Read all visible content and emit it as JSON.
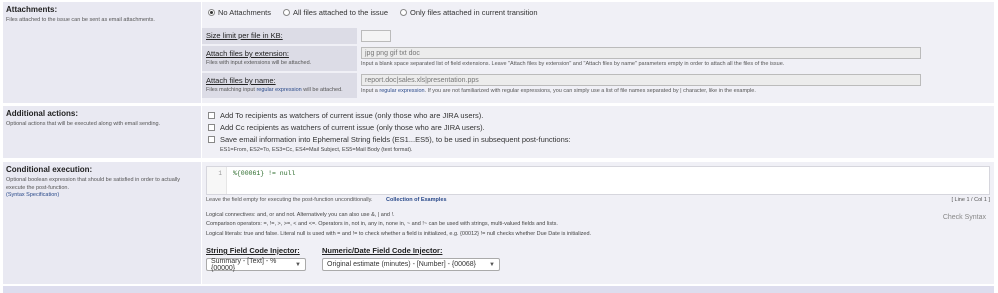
{
  "attachments": {
    "title": "Attachments:",
    "desc": "Files attached to the issue can be sent as email attachments.",
    "radios": [
      {
        "label": "No Attachments",
        "selected": true
      },
      {
        "label": "All files attached to the issue",
        "selected": false
      },
      {
        "label": "Only files attached in current transition",
        "selected": false
      }
    ],
    "size_limit": {
      "label": "Size limit per file in KB:",
      "value": ""
    },
    "by_extension": {
      "label": "Attach files by extension:",
      "help": "Files with input extensions will be attached.",
      "value": "jpg png gif txt doc",
      "hint": "Input a blank space separated list of field extensions. Leave \"Attach files by extension\" and \"Attach files by name\" parameters empty in order to attach all the files of the issue."
    },
    "by_name": {
      "label": "Attach files by name:",
      "help_pre": "Files matching input ",
      "help_link": "regular expression",
      "help_post": " will be attached.",
      "value": "report.doc|sales.xls|presentation.pps",
      "hint_pre": "Input a ",
      "hint_link": "regular expression",
      "hint_post": ". If you are not familiarized with regular expressions, you can simply use a list of file names separated by | character, like in the example."
    }
  },
  "additional": {
    "title": "Additional actions:",
    "desc": "Optional actions that will be executed along with email sending.",
    "opt1": "Add To recipients as watchers of current issue (only those who are JIRA users).",
    "opt2": "Add Cc recipients as watchers of current issue (only those who are JIRA users).",
    "opt3": "Save email information into Ephemeral String fields (ES1...ES5), to be used in subsequent post-functions:",
    "opt3_hint": "ES1=From, ES2=To, ES3=Cc, ES4=Mail Subject, ES5=Mail Body (text format)."
  },
  "conditional": {
    "title": "Conditional execution:",
    "desc": "Optional boolean expression that should be satisfied in order to actually execute the post-function.",
    "link": "(Syntax Specification)",
    "line_number": "1",
    "code": "%{00061} != null",
    "empty_hint": "Leave the field empty for executing the post-function unconditionally.",
    "examples_link": "Collection of Examples",
    "cursor_pos": "[ Line 1 / Col 1 ]",
    "logical_connectives": "Logical connectives: and, or and not. Alternatively you can also use &, | and !.",
    "comparison_operators": "Comparison operators: =, !=, >, >=, < and <=. Operators in, not in, any in, none in, ~ and !~ can be used with strings, multi-valued fields and lists.",
    "logical_literals": "Logical literals: true and false. Literal null is used with = and != to check whether a field is initialized, e.g. {00012} != null checks whether Due Date is initialized.",
    "check_syntax": "Check Syntax",
    "string_injector": {
      "label": "String Field Code Injector:",
      "value": "Summary - [Text] - %{00000}"
    },
    "numeric_injector": {
      "label": "Numeric/Date Field Code Injector:",
      "value": "Original estimate (minutes) - [Number] - {00068}"
    }
  },
  "icons": {
    "dropdown": "chevron-down-icon"
  }
}
